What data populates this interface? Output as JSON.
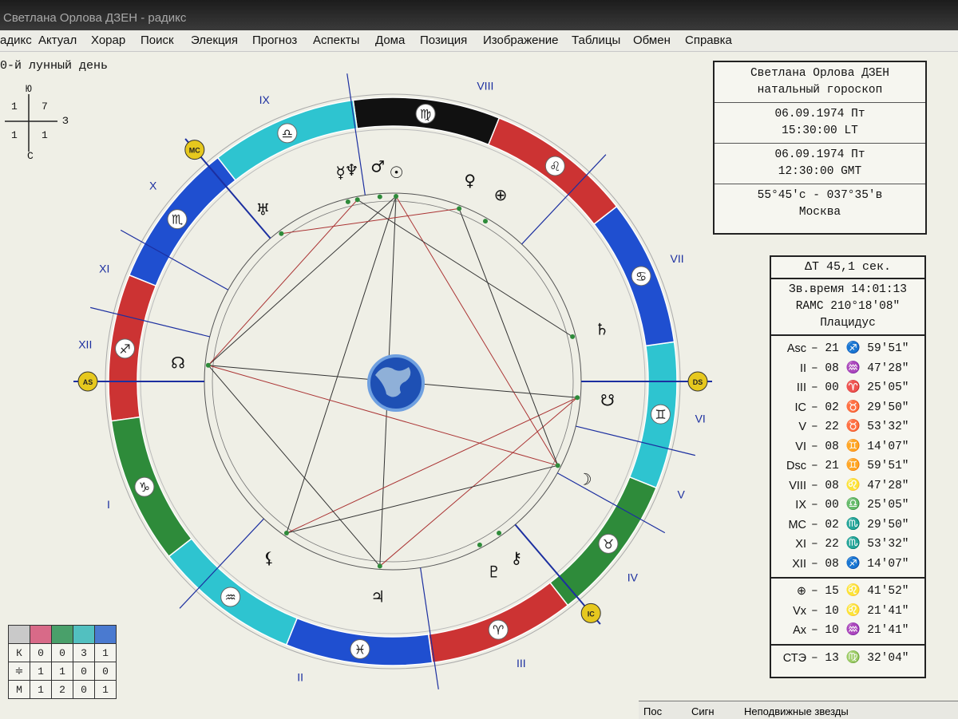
{
  "window": {
    "title": "Светлана Орлова ДЗЕН - радикс"
  },
  "menu": [
    "адикс",
    "Актуал",
    "Хорар",
    "Поиск",
    "Элекция",
    "Прогноз",
    "Аспекты",
    "Дома",
    "Позиция",
    "Изображение",
    "Таблицы",
    "Обмен",
    "Справка"
  ],
  "lunar_day": "0-й лунный день",
  "quadrant_cross": {
    "north": "Ю",
    "south": "С",
    "east": "З",
    "tl": "1",
    "tr": "7",
    "bl": "1",
    "br": "1"
  },
  "chart": {
    "house_numerals": [
      "I",
      "II",
      "III",
      "IV",
      "V",
      "VI",
      "VII",
      "VIII",
      "IX",
      "X",
      "XI",
      "XII"
    ],
    "angle_badges": {
      "asc": "AS",
      "dsc": "DS",
      "mc": "MC",
      "ic": "IC"
    },
    "signs": [
      "♈",
      "♉",
      "♊",
      "♋",
      "♌",
      "♍",
      "♎",
      "♏",
      "♐",
      "♑",
      "♒",
      "♓"
    ],
    "sign_colors": [
      "#cc3333",
      "#2e8b3a",
      "#2ec4d0",
      "#1f4fd0",
      "#cc3333",
      "#111111",
      "#2ec4d0",
      "#1f4fd0",
      "#cc3333",
      "#2e8b3a",
      "#2ec4d0",
      "#1f4fd0"
    ],
    "planets": [
      {
        "name": "sun",
        "glyph": "☉"
      },
      {
        "name": "moon",
        "glyph": "☽"
      },
      {
        "name": "mercury",
        "glyph": "☿"
      },
      {
        "name": "venus",
        "glyph": "♀"
      },
      {
        "name": "mars",
        "glyph": "♂"
      },
      {
        "name": "jupiter",
        "glyph": "♃"
      },
      {
        "name": "saturn",
        "glyph": "♄"
      },
      {
        "name": "uranus",
        "glyph": "♅"
      },
      {
        "name": "neptune",
        "glyph": "♆"
      },
      {
        "name": "pluto",
        "glyph": "♇"
      },
      {
        "name": "north-node",
        "glyph": "☊"
      },
      {
        "name": "south-node",
        "glyph": "☋"
      },
      {
        "name": "chiron",
        "glyph": "⚷"
      },
      {
        "name": "lilith",
        "glyph": "⚸"
      },
      {
        "name": "part-of-fortune",
        "glyph": "⊕"
      }
    ]
  },
  "info_panel": {
    "name": "Светлана Орлова ДЗЕН",
    "chart_type": "натальный гороскоп",
    "local_date": "06.09.1974 Пт",
    "local_time": "15:30:00 LT",
    "gmt_date": "06.09.1974 Пт",
    "gmt_time": "12:30:00 GMT",
    "coords": "55°45'с - 037°35'в",
    "city": "Москва"
  },
  "cusps_panel": {
    "delta_t": "ΔT 45,1 сек.",
    "sidereal": "Зв.время 14:01:13",
    "ramc": "RAMC 210°18'08\"",
    "system": "Плацидус",
    "cusps": [
      {
        "name": "Asc",
        "value": "– 21 ♐ 59'51\""
      },
      {
        "name": "II",
        "value": "– 08 ♒ 47'28\""
      },
      {
        "name": "III",
        "value": "– 00 ♈ 25'05\""
      },
      {
        "name": "IC",
        "value": "– 02 ♉ 29'50\""
      },
      {
        "name": "V",
        "value": "– 22 ♉ 53'32\""
      },
      {
        "name": "VI",
        "value": "– 08 ♊ 14'07\""
      },
      {
        "name": "Dsc",
        "value": "– 21 ♊ 59'51\""
      },
      {
        "name": "VIII",
        "value": "– 08 ♌ 47'28\""
      },
      {
        "name": "IX",
        "value": "– 00 ♎ 25'05\""
      },
      {
        "name": "MC",
        "value": "– 02 ♏ 29'50\""
      },
      {
        "name": "XI",
        "value": "– 22 ♏ 53'32\""
      },
      {
        "name": "XII",
        "value": "– 08 ♐ 14'07\""
      }
    ],
    "points": [
      {
        "name": "⊕",
        "value": "– 15 ♌ 41'52\""
      },
      {
        "name": "Vx",
        "value": "– 10 ♌ 21'41\""
      },
      {
        "name": "Ax",
        "value": "– 10 ♒ 21'41\""
      }
    ],
    "ste": {
      "name": "СТЭ",
      "value": "– 13 ♍ 32'04\""
    }
  },
  "element_table": {
    "header_colors": [
      "#c9c9c9",
      "#d86a88",
      "#49a06a",
      "#52c0c0",
      "#4a7ad0"
    ],
    "rows": [
      {
        "label": "К",
        "values": [
          "0",
          "0",
          "3",
          "1"
        ]
      },
      {
        "label": "≑",
        "values": [
          "1",
          "1",
          "0",
          "0"
        ]
      },
      {
        "label": "М",
        "values": [
          "1",
          "2",
          "0",
          "1"
        ]
      }
    ]
  },
  "bottom_tabs": [
    "Пос",
    "Сигн",
    "Неподвижные звезды"
  ]
}
